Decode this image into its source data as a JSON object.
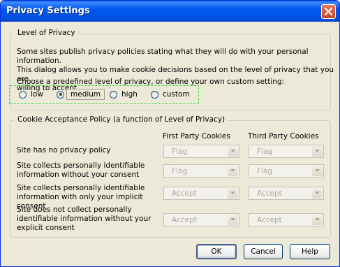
{
  "window": {
    "title": "Privacy Settings"
  },
  "level_group": {
    "legend": "Level of Privacy",
    "description_lines": [
      "Some sites publish privacy policies stating what they will do with your personal information.",
      "This dialog allows you to make cookie decisions based on the level of privacy that you are",
      "willing to accept."
    ],
    "choose_text": "Choose a predefined level of privacy, or define your own custom setting:",
    "options": [
      {
        "label": "low",
        "selected": false
      },
      {
        "label": "medium",
        "selected": true
      },
      {
        "label": "high",
        "selected": false
      },
      {
        "label": "custom",
        "selected": false
      }
    ]
  },
  "cookie_group": {
    "legend": "Cookie Acceptance Policy (a function of Level of Privacy)",
    "first_party_header": "First Party Cookies",
    "third_party_header": "Third Party Cookies",
    "rows": [
      {
        "label_lines": [
          "Site has no privacy policy"
        ],
        "first": "Flag",
        "third": "Flag"
      },
      {
        "label_lines": [
          "Site collects personally identifiable",
          "information without your consent"
        ],
        "first": "Flag",
        "third": "Flag"
      },
      {
        "label_lines": [
          "Site collects personally identifiable",
          "information with only your implicit consent"
        ],
        "first": "Accept",
        "third": "Accept"
      },
      {
        "label_lines": [
          "Site does not collect personally",
          "identifiable information without your",
          "explicit consent"
        ],
        "first": "Accept",
        "third": "Accept"
      }
    ]
  },
  "buttons": {
    "ok": "OK",
    "cancel": "Cancel",
    "help": "Help"
  }
}
